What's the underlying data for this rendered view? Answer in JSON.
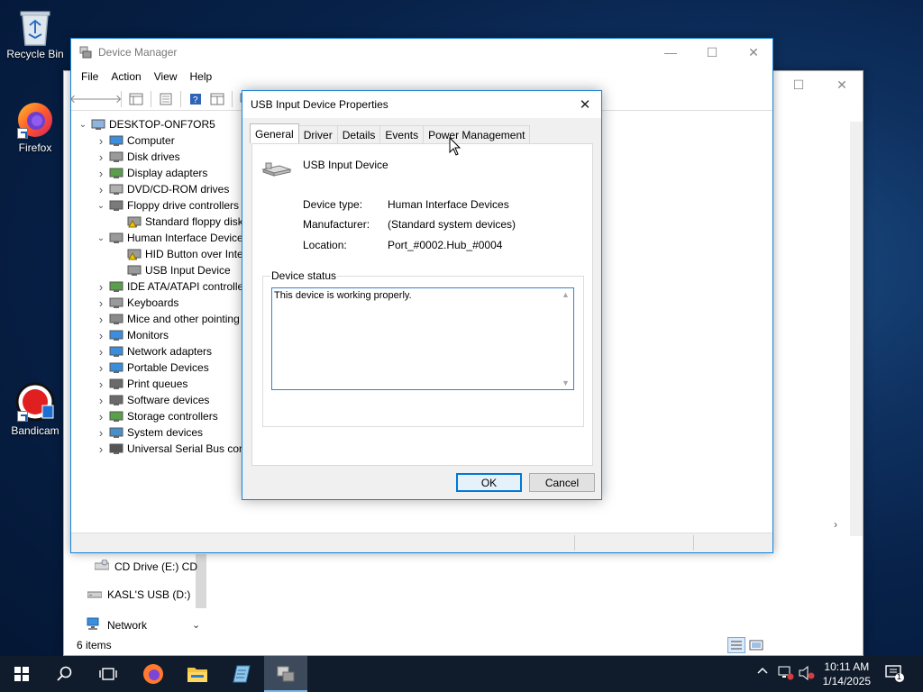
{
  "desktop": {
    "icons": [
      {
        "label": "Recycle Bin",
        "icon": "recycle-bin-icon"
      },
      {
        "label": "Firefox",
        "icon": "firefox-icon"
      },
      {
        "label": "Bandicam",
        "icon": "bandicam-icon"
      }
    ]
  },
  "explorer": {
    "nav_items": [
      {
        "label": "CD Drive (E:) CD",
        "icon": "cd-drive-icon"
      },
      {
        "label": "KASL'S USB (D:)",
        "icon": "usb-drive-icon"
      },
      {
        "label": "Network",
        "icon": "network-icon"
      }
    ],
    "status": "6 items"
  },
  "device_manager": {
    "title": "Device Manager",
    "menu": [
      "File",
      "Action",
      "View",
      "Help"
    ],
    "tree": [
      {
        "label": "DESKTOP-ONF7OR5",
        "level": 0,
        "expanded": true,
        "icon": "computer-root-icon"
      },
      {
        "label": "Computer",
        "level": 1,
        "expanded": false,
        "icon": "monitor-icon"
      },
      {
        "label": "Disk drives",
        "level": 1,
        "expanded": false,
        "icon": "disk-drive-icon"
      },
      {
        "label": "Display adapters",
        "level": 1,
        "expanded": false,
        "icon": "display-adapter-icon"
      },
      {
        "label": "DVD/CD-ROM drives",
        "level": 1,
        "expanded": false,
        "icon": "dvd-drive-icon"
      },
      {
        "label": "Floppy drive controllers",
        "level": 1,
        "expanded": true,
        "icon": "floppy-controller-icon"
      },
      {
        "label": "Standard floppy disk",
        "level": 2,
        "expanded": null,
        "icon": "warning-device-icon"
      },
      {
        "label": "Human Interface Device",
        "level": 1,
        "expanded": true,
        "icon": "hid-icon"
      },
      {
        "label": "HID Button over Inte",
        "level": 2,
        "expanded": null,
        "icon": "warning-device-icon"
      },
      {
        "label": "USB Input Device",
        "level": 2,
        "expanded": null,
        "icon": "hid-icon"
      },
      {
        "label": "IDE ATA/ATAPI controlle",
        "level": 1,
        "expanded": false,
        "icon": "ide-controller-icon"
      },
      {
        "label": "Keyboards",
        "level": 1,
        "expanded": false,
        "icon": "keyboard-icon"
      },
      {
        "label": "Mice and other pointing",
        "level": 1,
        "expanded": false,
        "icon": "mouse-icon"
      },
      {
        "label": "Monitors",
        "level": 1,
        "expanded": false,
        "icon": "monitor-icon"
      },
      {
        "label": "Network adapters",
        "level": 1,
        "expanded": false,
        "icon": "network-adapter-icon"
      },
      {
        "label": "Portable Devices",
        "level": 1,
        "expanded": false,
        "icon": "portable-device-icon"
      },
      {
        "label": "Print queues",
        "level": 1,
        "expanded": false,
        "icon": "printer-icon"
      },
      {
        "label": "Software devices",
        "level": 1,
        "expanded": false,
        "icon": "software-device-icon"
      },
      {
        "label": "Storage controllers",
        "level": 1,
        "expanded": false,
        "icon": "storage-controller-icon"
      },
      {
        "label": "System devices",
        "level": 1,
        "expanded": false,
        "icon": "system-device-icon"
      },
      {
        "label": "Universal Serial Bus cont",
        "level": 1,
        "expanded": false,
        "icon": "usb-icon"
      }
    ]
  },
  "properties": {
    "title": "USB Input Device Properties",
    "tabs": [
      "General",
      "Driver",
      "Details",
      "Events",
      "Power Management"
    ],
    "active_tab": "General",
    "device_name": "USB Input Device",
    "fields": [
      {
        "label": "Device type:",
        "value": "Human Interface Devices"
      },
      {
        "label": "Manufacturer:",
        "value": "(Standard system devices)"
      },
      {
        "label": "Location:",
        "value": "Port_#0002.Hub_#0004"
      }
    ],
    "status_group_label": "Device status",
    "status_text": "This device is working properly.",
    "ok_label": "OK",
    "cancel_label": "Cancel"
  },
  "taskbar": {
    "time": "10:11 AM",
    "date": "1/14/2025",
    "notification_count": "1"
  },
  "colors": {
    "accent": "#0078d7",
    "taskbar": "#101c2c",
    "desktop": "#0f3262"
  }
}
